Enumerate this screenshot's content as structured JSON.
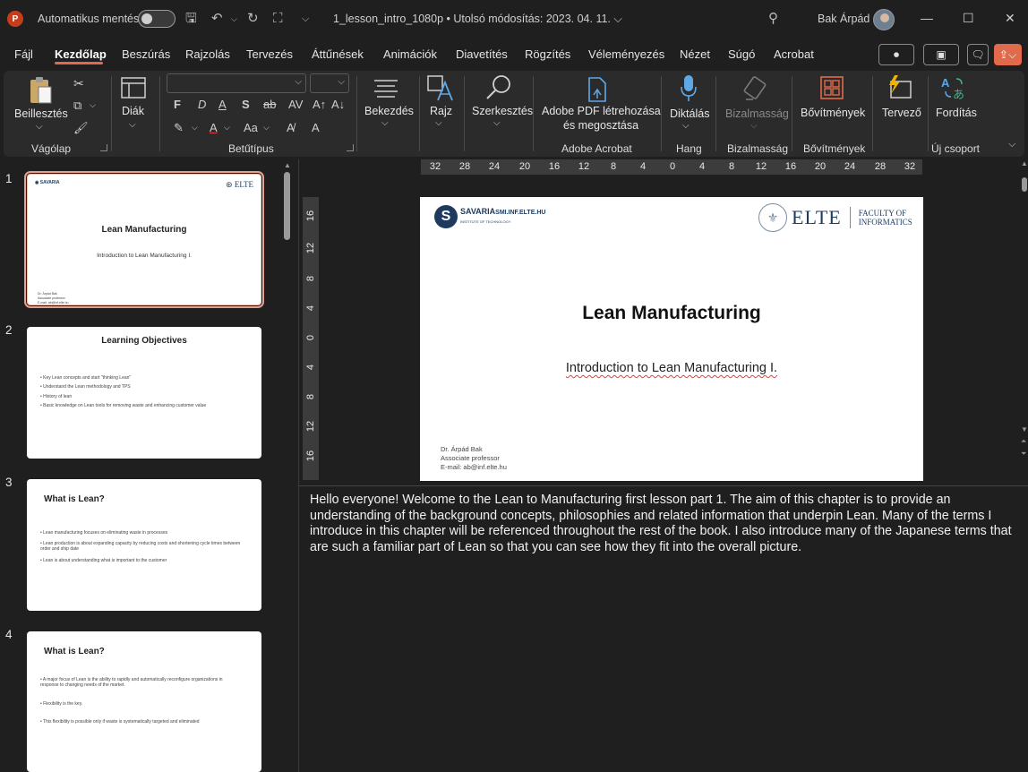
{
  "titlebar": {
    "autosave_label": "Automatikus mentés",
    "doc_title": "1_lesson_intro_1080p • Utolsó módosítás: 2023. 04. 11. ⌵",
    "user_name": "Bak Árpád"
  },
  "menu": {
    "tabs": [
      "Fájl",
      "Kezdőlap",
      "Beszúrás",
      "Rajzolás",
      "Tervezés",
      "Áttűnések",
      "Animációk",
      "Diavetítés",
      "Rögzítés",
      "Véleményezés",
      "Nézet",
      "Súgó",
      "Acrobat"
    ],
    "active": "Kezdőlap"
  },
  "ribbon": {
    "paste_label": "Beillesztés",
    "clipboard_group": "Vágólap",
    "slide_label": "Diák",
    "font_group": "Betűtípus",
    "paragraph_label": "Bekezdés",
    "drawing_label": "Rajz",
    "editing_label": "Szerkesztés",
    "adobe_label_1": "Adobe PDF létrehozása",
    "adobe_label_2": "és megosztása",
    "adobe_group": "Adobe Acrobat",
    "dictate_label": "Diktálás",
    "voice_group": "Hang",
    "sensitivity_label": "Bizalmasság",
    "sensitivity_group": "Bizalmasság",
    "addins_label": "Bővítmények",
    "addins_group": "Bővítmények",
    "designer_label": "Tervező",
    "translate_label": "Fordítás",
    "new_group": "Új csoport",
    "bold_glyph": "F",
    "italic_glyph": "D",
    "underline_glyph": "A",
    "strike_glyph": "S"
  },
  "thumbnails": [
    {
      "num": "1",
      "title": "Lean Manufacturing",
      "subtitle": "Introduction to Lean Manufacturing I.",
      "author_lines": [
        "Dr. Árpád Bak",
        "Associate professor",
        "E-mail: ab@inf.elte.hu"
      ]
    },
    {
      "num": "2",
      "title": "Learning Objectives",
      "bullets": [
        "• Key Lean concepts and start \"thinking Lean\"",
        "• Understand the Lean methodology and TPS",
        "• History of lean",
        "• Basic knowledge on Lean tools for removing waste and enhancing customer value"
      ]
    },
    {
      "num": "3",
      "title": "What is Lean?",
      "bullets": [
        "• Lean manufacturing focuses on eliminating waste in processes",
        "• Lean production is about expanding capacity by reducing costs and shortening cycle times between order and ship date",
        "• Lean is about understanding what is important to the customer"
      ]
    },
    {
      "num": "4",
      "title": "What is Lean?",
      "bullets": [
        "• A major focus of Lean is the ability to rapidly and automatically reconfigure organizations in response to changing needs of the market.",
        "• Flexibility is the key.",
        "• This flexibility is possible only if waste is systematically targeted and eliminated"
      ]
    }
  ],
  "ruler": {
    "h_ticks": [
      "32",
      "28",
      "24",
      "20",
      "16",
      "12",
      "8",
      "4",
      "0",
      "4",
      "8",
      "12",
      "16",
      "20",
      "24",
      "28",
      "32"
    ],
    "v_ticks": [
      "16",
      "12",
      "8",
      "4",
      "0",
      "4",
      "8",
      "12",
      "16"
    ]
  },
  "slide": {
    "logo_savaria": "SAVARIA",
    "logo_savaria_sub": "INSTITUTE OF TECHNOLOGY",
    "logo_smi": "SMI.INF.ELTE.HU",
    "logo_elte": "ELTE",
    "logo_faculty_1": "FACULTY OF",
    "logo_faculty_2": "INFORMATICS",
    "title": "Lean Manufacturing",
    "subtitle": "Introduction to Lean Manufacturing I.",
    "author": "Dr. Árpád Bak",
    "position": "Associate professor",
    "email": "E-mail: ab@inf.elte.hu"
  },
  "notes": "Hello everyone! Welcome to the Lean to Manufacturing first lesson part 1. The aim of this chapter is to provide an understanding of the background concepts, philosophies and related information that underpin Lean. Many of the terms I introduce in this chapter will be referenced throughout the rest of the book. I also introduce many of the Japanese terms that are such a familiar part of Lean so that you can see how they fit into the overall picture.",
  "colors": {
    "accent": "#e06a4b",
    "background": "#1f1f1f",
    "ribbon": "#2b2b2b",
    "brand_blue": "#1e3a5f"
  }
}
